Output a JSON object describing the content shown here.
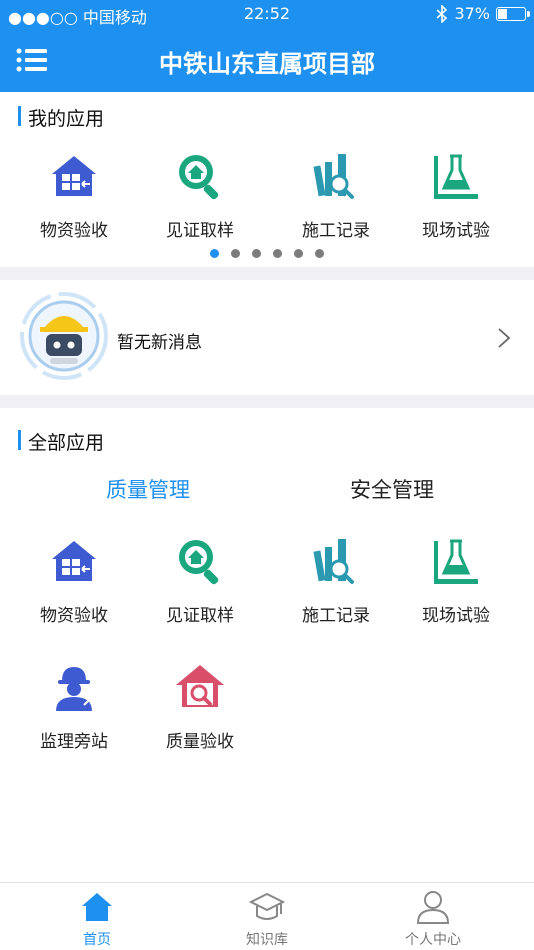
{
  "status": {
    "carrier": "●●●○○ 中国移动",
    "time": "22:52",
    "battery": "37%",
    "battery_level": 0.37
  },
  "header": {
    "title": "中铁山东直属项目部"
  },
  "my_apps": {
    "title": "我的应用",
    "items": [
      {
        "label": "物资验收",
        "icon": "warehouse-icon"
      },
      {
        "label": "见证取样",
        "icon": "magnifier-house-icon"
      },
      {
        "label": "施工记录",
        "icon": "books-search-icon"
      },
      {
        "label": "现场试验",
        "icon": "flask-icon"
      }
    ],
    "pages": 6,
    "current_page": 1
  },
  "message": {
    "text": "暂无新消息"
  },
  "all_apps": {
    "title": "全部应用",
    "tabs": [
      {
        "label": "质量管理",
        "active": true
      },
      {
        "label": "安全管理",
        "active": false
      }
    ],
    "items": [
      {
        "label": "物资验收",
        "icon": "warehouse-icon"
      },
      {
        "label": "见证取样",
        "icon": "magnifier-house-icon"
      },
      {
        "label": "施工记录",
        "icon": "books-search-icon"
      },
      {
        "label": "现场试验",
        "icon": "flask-icon"
      },
      {
        "label": "监理旁站",
        "icon": "worker-icon"
      },
      {
        "label": "质量验收",
        "icon": "house-search-icon"
      }
    ]
  },
  "tabbar": {
    "items": [
      {
        "label": "首页",
        "icon": "home-icon",
        "active": true
      },
      {
        "label": "知识库",
        "icon": "graduation-cap-icon",
        "active": false
      },
      {
        "label": "个人中心",
        "icon": "person-icon",
        "active": false
      }
    ]
  },
  "colors": {
    "primary": "#1e90f0",
    "green": "#1aa67e",
    "purple": "#3e5bd1",
    "teal": "#2b9ab0",
    "red": "#d94f6a"
  }
}
